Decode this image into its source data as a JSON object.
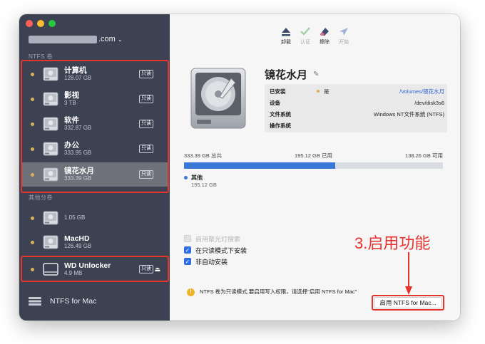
{
  "account": {
    "email_suffix": ".com",
    "chevron": "chevron-down-icon"
  },
  "sidebar": {
    "ntfs_section": "NTFS 卷",
    "ntfs_volumes": [
      {
        "name": "计算机",
        "size": "128.07 GB",
        "badge": "只读"
      },
      {
        "name": "影视",
        "size": "3 TB",
        "badge": "只读"
      },
      {
        "name": "软件",
        "size": "332.87 GB",
        "badge": "只读"
      },
      {
        "name": "办公",
        "size": "333.95 GB",
        "badge": "只读"
      },
      {
        "name": "镜花水月",
        "size": "333.39 GB",
        "badge": "只读",
        "selected": true
      }
    ],
    "other_section": "其他分卷",
    "other_volumes": [
      {
        "name": "",
        "size": "1.05 GB"
      },
      {
        "name": "MacHD",
        "size": "126.49 GB"
      },
      {
        "name": "WD Unlocker",
        "size": "4.9 MB",
        "badge": "只读"
      }
    ],
    "footer_label": "NTFS for Mac"
  },
  "toolbar": {
    "items": [
      {
        "label": "卸载",
        "icon": "eject-icon",
        "enabled": true
      },
      {
        "label": "认证",
        "icon": "checkmark-icon",
        "enabled": false
      },
      {
        "label": "擦除",
        "icon": "eraser-icon",
        "enabled": true
      },
      {
        "label": "开始",
        "icon": "send-icon",
        "enabled": false
      }
    ]
  },
  "volume": {
    "title": "镜花水月",
    "info": {
      "mounted_label": "已安装",
      "mounted_value": "是",
      "mounted_path": "/Volumes/镜花水月",
      "device_label": "设备",
      "device_value": "/dev/disk3s6",
      "filesystem_label": "文件系统",
      "filesystem_value": "Windows NT文件系统 (NTFS)",
      "os_label": "操作系统",
      "os_value": ""
    },
    "capacity": {
      "total": "333.39 GB 总共",
      "used": "195.12 GB 已用",
      "free": "138.26 GB 可用",
      "used_fraction": 0.585
    },
    "legend": {
      "name": "其他",
      "size": "195.12 GB"
    }
  },
  "options": {
    "spotlight": "启用聚光灯搜索",
    "readonly_mount": "在只读模式下安装",
    "no_automount": "非自动安装"
  },
  "annotation": "3.启用功能",
  "notice": "NTFS 卷为只读模式.要启用写入权限，请选择\"启用 NTFS for Mac\"",
  "enable_button": "启用 NTFS for Mac...",
  "colors": {
    "accent": "#3a78d8",
    "highlight": "#e5332d",
    "sidebar": "#3d4252"
  }
}
